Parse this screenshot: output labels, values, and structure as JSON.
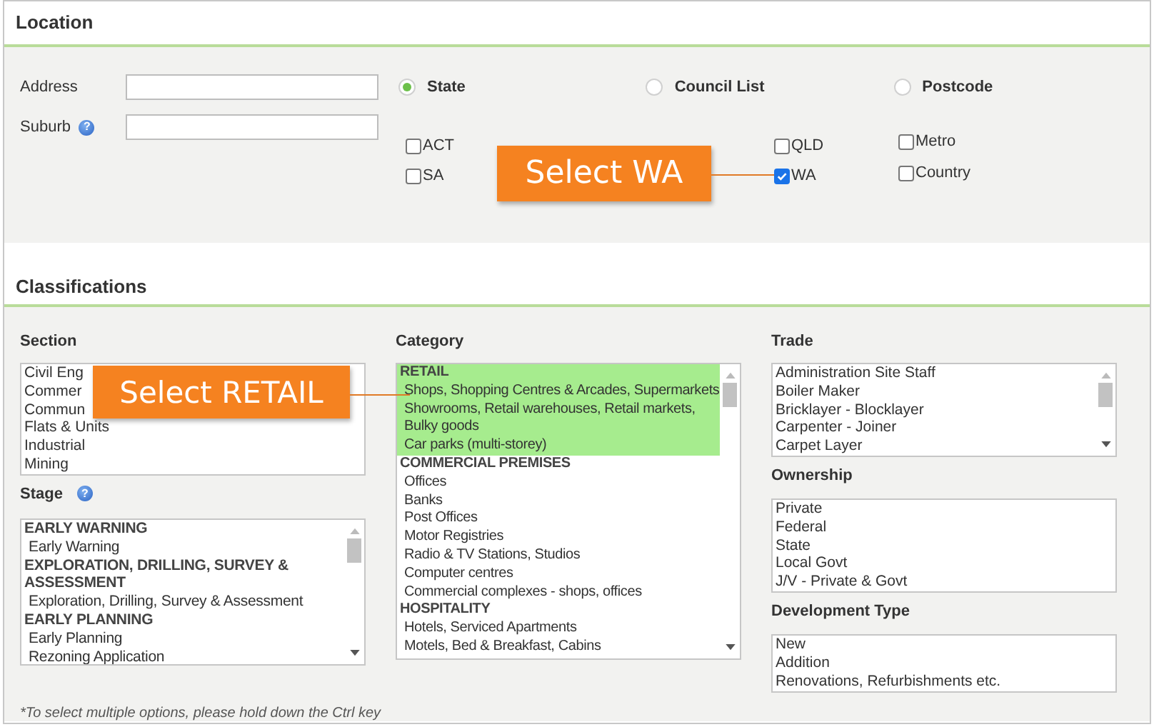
{
  "location": {
    "title": "Location",
    "fields": [
      {
        "label": "Address"
      },
      {
        "label": "Suburb",
        "help": "?"
      }
    ],
    "modes": [
      {
        "label": "State",
        "selected": true
      },
      {
        "label": "Council List",
        "selected": false
      },
      {
        "label": "Postcode",
        "selected": false
      }
    ],
    "states": {
      "row_1": [
        {
          "label": "ACT",
          "checked": false
        },
        {
          "label": "QLD",
          "checked": false
        }
      ],
      "row_2": [
        {
          "label": "SA",
          "checked": false
        },
        {
          "label": "WA",
          "checked": true
        }
      ]
    },
    "areas": [
      {
        "label": "Metro",
        "checked": false
      },
      {
        "label": "Country",
        "checked": false
      }
    ],
    "callout": "Select WA"
  },
  "classifications": {
    "title": "Classifications",
    "columns": [
      [
        {
          "label": "Section",
          "scrollable": false,
          "options": [
            {
              "text": "Civil Eng",
              "kind": "item",
              "selected": false
            },
            {
              "text": "Commer",
              "kind": "item",
              "selected": false
            },
            {
              "text": "Commun",
              "kind": "item",
              "selected": false
            },
            {
              "text": "Flats & Units",
              "kind": "item",
              "selected": false
            },
            {
              "text": "Industrial",
              "kind": "item",
              "selected": false
            },
            {
              "text": "Mining",
              "kind": "item",
              "selected": false
            }
          ]
        },
        {
          "label": "Stage",
          "help": "?",
          "scrollable": true,
          "options": [
            {
              "text": "EARLY WARNING",
              "kind": "heading",
              "selected": false
            },
            {
              "text": "Early Warning",
              "kind": "item",
              "selected": false
            },
            {
              "text": "EXPLORATION, DRILLING, SURVEY & ASSESSMENT",
              "kind": "heading",
              "selected": false
            },
            {
              "text": "Exploration, Drilling, Survey & Assessment",
              "kind": "item",
              "selected": false
            },
            {
              "text": "EARLY PLANNING",
              "kind": "heading",
              "selected": false
            },
            {
              "text": "Early Planning",
              "kind": "item",
              "selected": false
            },
            {
              "text": "Rezoning Application",
              "kind": "item",
              "selected": false
            }
          ]
        }
      ],
      [
        {
          "label": "Category",
          "scrollable": true,
          "options": [
            {
              "text": "RETAIL",
              "kind": "heading",
              "selected": true
            },
            {
              "text": "Shops, Shopping Centres & Arcades, Supermarkets",
              "kind": "item",
              "selected": true
            },
            {
              "text": "Showrooms, Retail warehouses, Retail markets, Bulky goods",
              "kind": "item",
              "selected": true
            },
            {
              "text": "Car parks (multi-storey)",
              "kind": "item",
              "selected": true
            },
            {
              "text": "COMMERCIAL PREMISES",
              "kind": "heading",
              "selected": false
            },
            {
              "text": "Offices",
              "kind": "item",
              "selected": false
            },
            {
              "text": "Banks",
              "kind": "item",
              "selected": false
            },
            {
              "text": "Post Offices",
              "kind": "item",
              "selected": false
            },
            {
              "text": "Motor Registries",
              "kind": "item",
              "selected": false
            },
            {
              "text": "Radio & TV Stations, Studios",
              "kind": "item",
              "selected": false
            },
            {
              "text": "Computer centres",
              "kind": "item",
              "selected": false
            },
            {
              "text": "Commercial complexes - shops, offices",
              "kind": "item",
              "selected": false
            },
            {
              "text": "HOSPITALITY",
              "kind": "heading",
              "selected": false
            },
            {
              "text": "Hotels, Serviced Apartments",
              "kind": "item",
              "selected": false
            },
            {
              "text": "Motels, Bed & Breakfast, Cabins",
              "kind": "item",
              "selected": false
            }
          ]
        }
      ],
      [
        {
          "label": "Trade",
          "scrollable": true,
          "options": [
            {
              "text": "Administration Site Staff",
              "kind": "item",
              "selected": false
            },
            {
              "text": "Boiler Maker",
              "kind": "item",
              "selected": false
            },
            {
              "text": "Bricklayer - Blocklayer",
              "kind": "item",
              "selected": false
            },
            {
              "text": "Carpenter - Joiner",
              "kind": "item",
              "selected": false
            },
            {
              "text": "Carpet Layer",
              "kind": "item",
              "selected": false
            }
          ]
        },
        {
          "label": "Ownership",
          "scrollable": false,
          "options": [
            {
              "text": "Private",
              "kind": "item",
              "selected": false
            },
            {
              "text": "Federal",
              "kind": "item",
              "selected": false
            },
            {
              "text": "State",
              "kind": "item",
              "selected": false
            },
            {
              "text": "Local Govt",
              "kind": "item",
              "selected": false
            },
            {
              "text": "J/V - Private & Govt",
              "kind": "item",
              "selected": false
            }
          ]
        },
        {
          "label": "Development Type",
          "scrollable": false,
          "options": [
            {
              "text": "New",
              "kind": "item",
              "selected": false
            },
            {
              "text": "Addition",
              "kind": "item",
              "selected": false
            },
            {
              "text": "Renovations, Refurbishments etc.",
              "kind": "item",
              "selected": false
            }
          ]
        }
      ]
    ],
    "note": "*To select multiple options, please hold down the Ctrl key",
    "callout": "Select RETAIL"
  }
}
